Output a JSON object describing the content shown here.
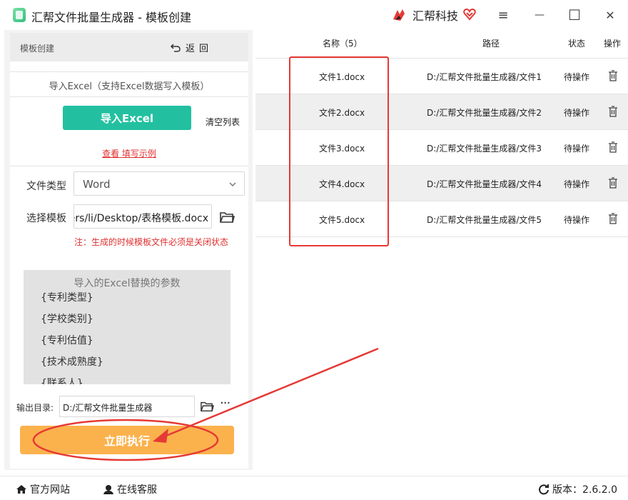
{
  "window": {
    "title": "汇帮文件批量生成器 - 模板创建",
    "brand_name": "汇帮科技",
    "menu_glyph": "≡",
    "minimize_glyph": "—",
    "maximize_glyph": "☐",
    "close_glyph": "✕"
  },
  "left": {
    "breadcrumb": "模板创建",
    "back_label": "返回",
    "import_hint": "导入Excel（支持Excel数据写入模板）",
    "import_button": "导入Excel",
    "clear_button": "清空列表",
    "example_link": "查看 填写示例",
    "file_type_label": "文件类型",
    "file_type_value": "Word",
    "template_label": "选择模板",
    "template_value": "ers/li/Desktop/表格模板.docx",
    "warning": "注：生成的时候模板文件必须是关闭状态",
    "params_title": "导入的Excel替换的参数",
    "params": [
      "{专利类型}",
      "{学校类别}",
      "{专利估值}",
      "{技术成熟度}",
      "{联系人}"
    ],
    "output_label": "输出目录:",
    "output_value": "D:/汇帮文件批量生成器",
    "more_glyph": "···",
    "run_button": "立即执行"
  },
  "table": {
    "headers": {
      "name": "名称（5）",
      "path": "路径",
      "status": "状态",
      "action": "操作"
    },
    "rows": [
      {
        "name": "文件1.docx",
        "path": "D:/汇帮文件批量生成器/文件1",
        "status": "待操作"
      },
      {
        "name": "文件2.docx",
        "path": "D:/汇帮文件批量生成器/文件2",
        "status": "待操作"
      },
      {
        "name": "文件3.docx",
        "path": "D:/汇帮文件批量生成器/文件3",
        "status": "待操作"
      },
      {
        "name": "文件4.docx",
        "path": "D:/汇帮文件批量生成器/文件4",
        "status": "待操作"
      },
      {
        "name": "文件5.docx",
        "path": "D:/汇帮文件批量生成器/文件5",
        "status": "待操作"
      }
    ]
  },
  "footer": {
    "website": "官方网站",
    "support": "在线客服",
    "version": "版本：2.6.2.0"
  },
  "colors": {
    "accent_green": "#22c0a0",
    "run_orange": "#fbb24d",
    "warning_red": "#e03030",
    "annotation_red": "#e53935"
  },
  "icons": [
    "app-icon",
    "brand-logo-icon",
    "heart-icon",
    "menu-icon",
    "minimize-icon",
    "maximize-icon",
    "close-icon",
    "back-arrow-icon",
    "chevron-down-icon",
    "folder-icon",
    "more-icon",
    "trash-icon",
    "home-icon",
    "support-icon",
    "refresh-icon"
  ]
}
